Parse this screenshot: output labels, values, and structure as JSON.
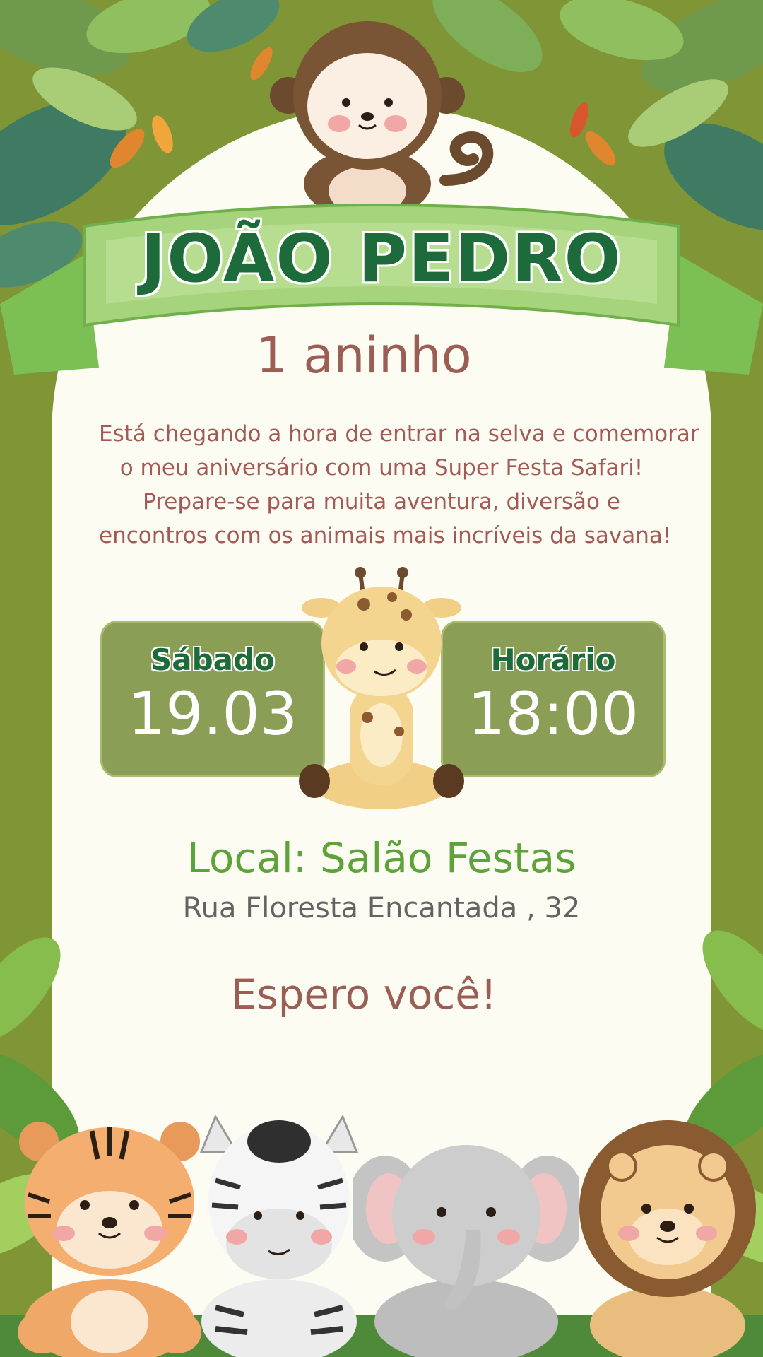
{
  "colors": {
    "background": "#7f9536",
    "panel": "#fdfcf3",
    "name": "#1d6a3a",
    "accent_text": "#a35a55",
    "venue": "#5ea33a",
    "info_box": "#8b9e56"
  },
  "invitation": {
    "name": "JOÃO PEDRO",
    "age": "1 aninho",
    "message_lines": [
      "Está chegando a hora de entrar na selva e comemorar",
      "o meu aniversário com uma Super Festa Safari!",
      "Prepare-se para muita aventura, diversão e",
      "encontros com os animais mais incríveis da savana!"
    ],
    "date_label": "Sábado",
    "date_value": "19.03",
    "time_label": "Horário",
    "time_value": "18:00",
    "venue": "Local: Salão Festas",
    "address": "Rua Floresta Encantada , 32",
    "closing": "Espero você!"
  },
  "illustrations": [
    "monkey-icon",
    "giraffe-icon",
    "tiger-icon",
    "zebra-icon",
    "elephant-icon",
    "lion-icon",
    "leaf-icon"
  ]
}
